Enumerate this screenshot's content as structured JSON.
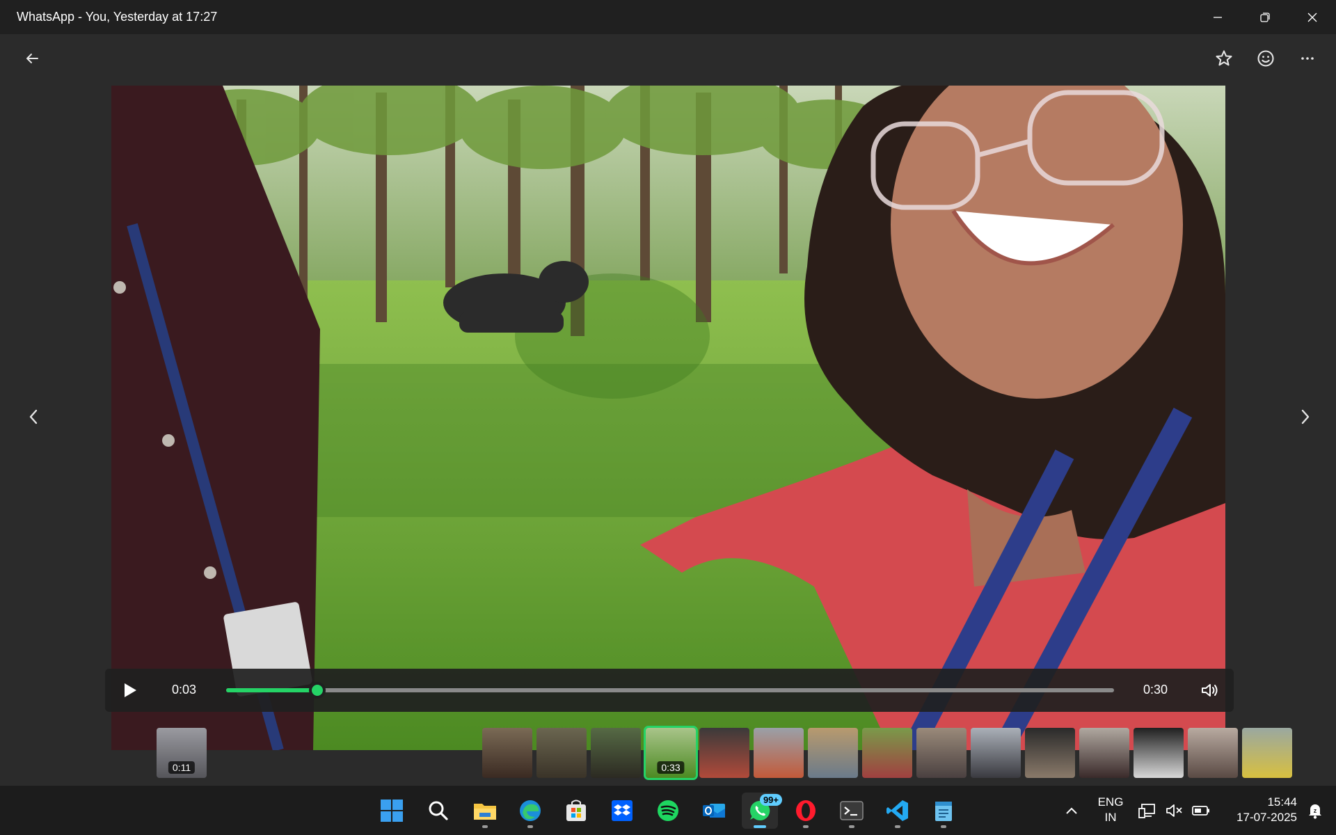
{
  "window": {
    "title": "WhatsApp - You, Yesterday at 17:27",
    "controls": [
      "minimize-icon",
      "restore-icon",
      "close-icon"
    ]
  },
  "viewer": {
    "toolbar_icons": [
      "back-arrow-icon",
      "star-icon",
      "emoji-icon",
      "more-icon"
    ],
    "player": {
      "current_time": "0:03",
      "duration": "0:30",
      "progress_fraction": 0.103,
      "accent_color": "#25d366"
    }
  },
  "thumbnails": {
    "left": {
      "duration": "0:11"
    },
    "selected_duration": "0:33",
    "count_right": 15
  },
  "taskbar": {
    "apps": [
      "windows-start-icon",
      "search-icon",
      "file-explorer-icon",
      "edge-icon",
      "microsoft-store-icon",
      "dropbox-icon",
      "spotify-icon",
      "outlook-icon",
      "whatsapp-icon",
      "opera-icon",
      "terminal-icon",
      "vscode-icon",
      "notepad-icon"
    ],
    "whatsapp_badge": "99+",
    "language_line1": "ENG",
    "language_line2": "IN",
    "time": "15:44",
    "date": "17-07-2025"
  }
}
